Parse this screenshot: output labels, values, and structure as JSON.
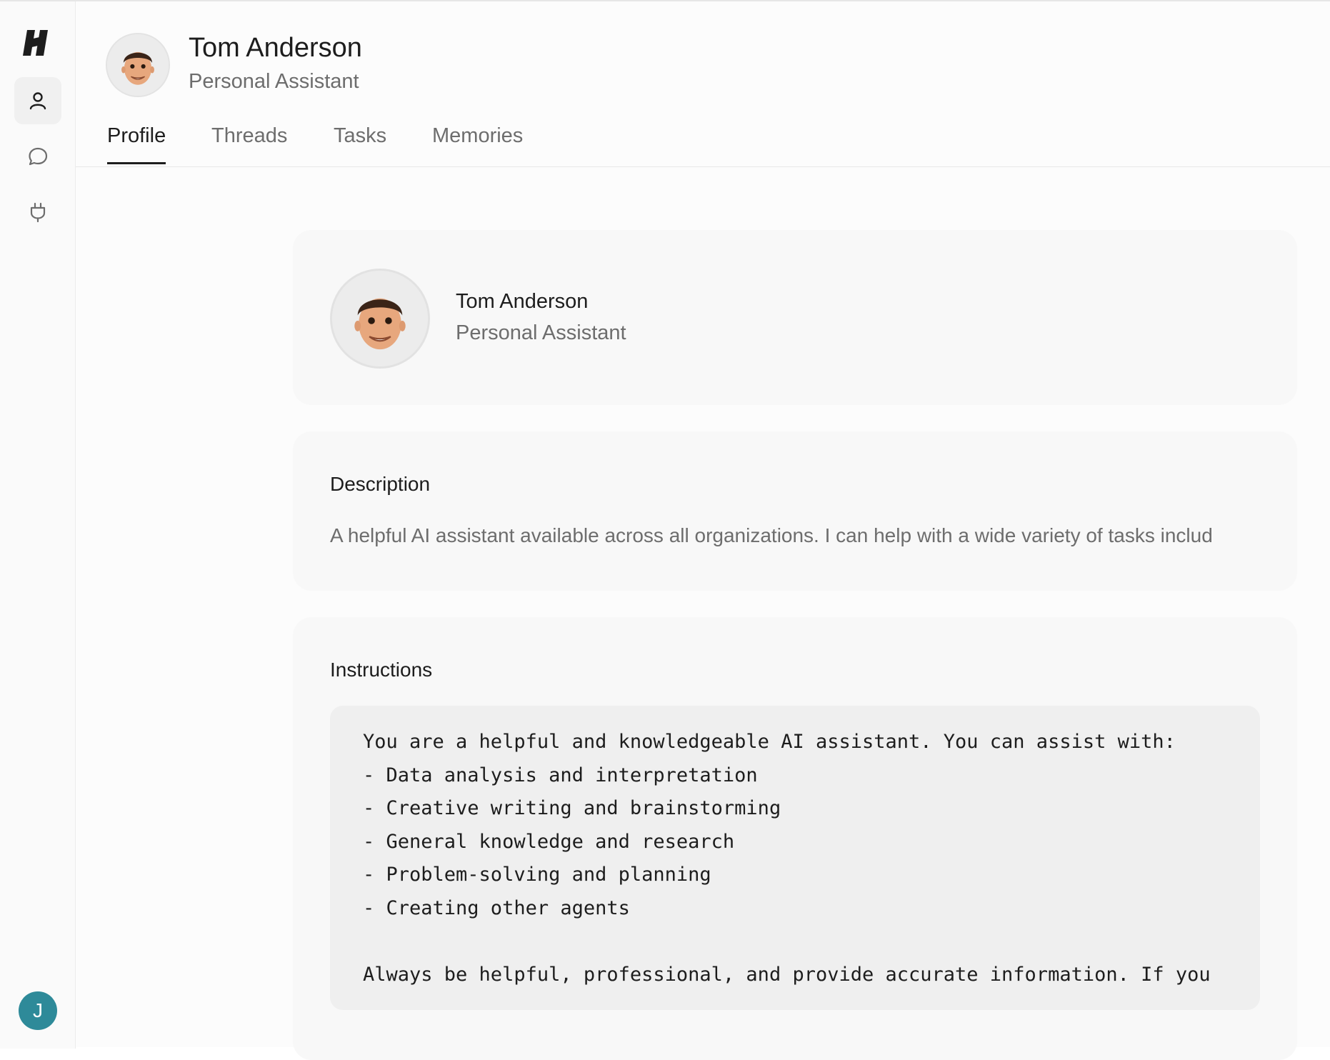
{
  "colors": {
    "accent_avatar": "#2e8a99",
    "text_primary": "#1d1d1d",
    "text_secondary": "#6d6d6d",
    "card_bg": "#f8f8f8",
    "code_bg": "#efefef"
  },
  "sidebar": {
    "logo_icon": "brand-logo-icon",
    "items": [
      {
        "name": "profile",
        "icon": "user-icon",
        "active": true
      },
      {
        "name": "threads",
        "icon": "chat-bubble-icon",
        "active": false
      },
      {
        "name": "integrations",
        "icon": "plug-icon",
        "active": false
      }
    ],
    "user_initial": "J"
  },
  "header": {
    "name": "Tom Anderson",
    "role": "Personal Assistant"
  },
  "tabs": [
    {
      "label": "Profile",
      "active": true
    },
    {
      "label": "Threads",
      "active": false
    },
    {
      "label": "Tasks",
      "active": false
    },
    {
      "label": "Memories",
      "active": false
    }
  ],
  "profile_card": {
    "name": "Tom Anderson",
    "role": "Personal Assistant"
  },
  "description": {
    "title": "Description",
    "text": "A helpful AI assistant available across all organizations. I can help with a wide variety of tasks includ"
  },
  "instructions": {
    "title": "Instructions",
    "lines": [
      "You are a helpful and knowledgeable AI assistant. You can assist with:",
      "- Data analysis and interpretation",
      "- Creative writing and brainstorming",
      "- General knowledge and research",
      "- Problem-solving and planning",
      "- Creating other agents",
      "",
      "Always be helpful, professional, and provide accurate information. If you"
    ]
  }
}
